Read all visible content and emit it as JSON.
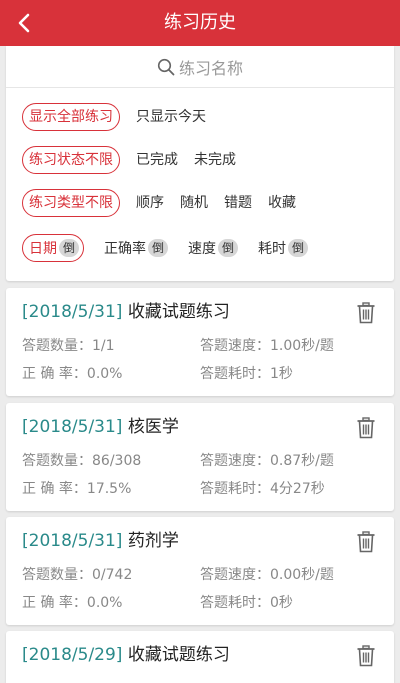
{
  "header": {
    "title": "练习历史"
  },
  "search": {
    "placeholder": "练习名称"
  },
  "filters": {
    "scope": {
      "active": "显示全部练习",
      "today": "只显示今天"
    },
    "status": {
      "active": "练习状态不限",
      "done": "已完成",
      "undone": "未完成"
    },
    "type": {
      "active": "练习类型不限",
      "options": [
        "顺序",
        "随机",
        "错题",
        "收藏"
      ]
    },
    "sort": [
      {
        "label": "日期",
        "badge": "倒"
      },
      {
        "label": "正确率",
        "badge": "倒"
      },
      {
        "label": "速度",
        "badge": "倒"
      },
      {
        "label": "耗时",
        "badge": "倒"
      }
    ]
  },
  "labels": {
    "count": "答题数量：",
    "speed": "答题速度：",
    "accuracy": "正 确 率：",
    "duration": "答题耗时："
  },
  "records": [
    {
      "date": "[2018/5/31]",
      "name": "收藏试题练习",
      "count": "1/1",
      "speed": "1.00秒/题",
      "accuracy": "0.0%",
      "duration": "1秒"
    },
    {
      "date": "[2018/5/31]",
      "name": "核医学",
      "count": "86/308",
      "speed": "0.87秒/题",
      "accuracy": "17.5%",
      "duration": "4分27秒"
    },
    {
      "date": "[2018/5/31]",
      "name": "药剂学",
      "count": "0/742",
      "speed": "0.00秒/题",
      "accuracy": "0.0%",
      "duration": "0秒"
    },
    {
      "date": "[2018/5/29]",
      "name": "收藏试题练习",
      "count": "",
      "speed": "",
      "accuracy": "",
      "duration": ""
    }
  ],
  "colors": {
    "brand": "#d8323a",
    "date": "#2a8a8a"
  },
  "icons": {
    "back": "back-arrow-icon",
    "search": "search-icon",
    "delete": "trash-icon"
  }
}
